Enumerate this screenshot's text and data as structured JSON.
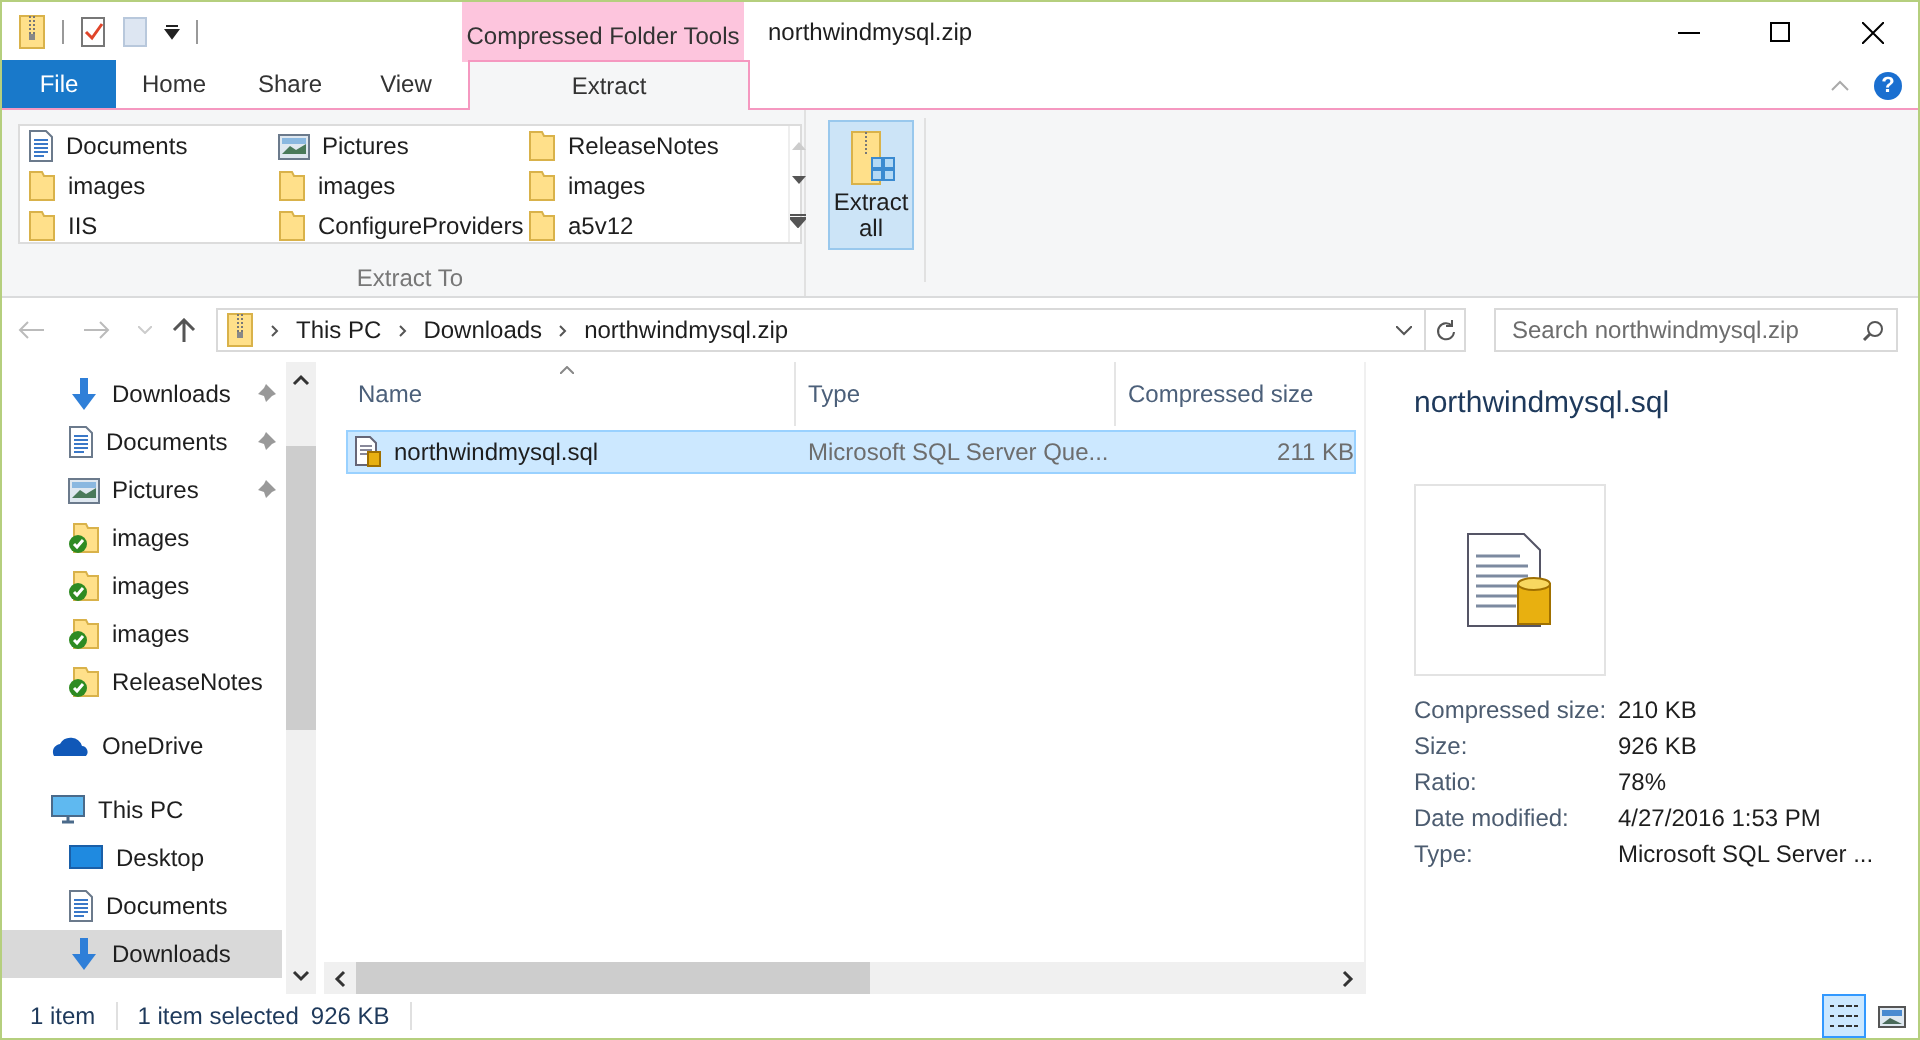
{
  "window": {
    "title": "northwindmysql.zip",
    "context_tab_group": "Compressed Folder Tools"
  },
  "ribbon_tabs": [
    {
      "label": "File",
      "kind": "file",
      "selected": false
    },
    {
      "label": "Home",
      "kind": "tab",
      "selected": false
    },
    {
      "label": "Share",
      "kind": "tab",
      "selected": false
    },
    {
      "label": "View",
      "kind": "tab",
      "selected": false
    },
    {
      "label": "Extract",
      "kind": "context",
      "selected": true
    }
  ],
  "extract_to": {
    "group_label": "Extract To",
    "items": [
      {
        "label": "Documents",
        "kind": "document"
      },
      {
        "label": "Pictures",
        "kind": "picture"
      },
      {
        "label": "ReleaseNotes",
        "kind": "folder"
      },
      {
        "label": "images",
        "kind": "folder"
      },
      {
        "label": "images",
        "kind": "folder"
      },
      {
        "label": "images",
        "kind": "folder"
      },
      {
        "label": "IIS",
        "kind": "folder"
      },
      {
        "label": "ConfigureProviders",
        "kind": "folder"
      },
      {
        "label": "a5v12",
        "kind": "folder"
      }
    ]
  },
  "extract_all_button": {
    "label": "Extract all",
    "selected": true
  },
  "breadcrumb": [
    "This PC",
    "Downloads",
    "northwindmysql.zip"
  ],
  "search": {
    "placeholder": "Search northwindmysql.zip"
  },
  "help_button": {
    "label": "?"
  },
  "sidebar": {
    "quick_access": [
      {
        "label": "Downloads",
        "kind": "download",
        "pinned": true,
        "selected": false
      },
      {
        "label": "Documents",
        "kind": "document",
        "pinned": true,
        "selected": false
      },
      {
        "label": "Pictures",
        "kind": "picture",
        "pinned": true,
        "selected": false
      },
      {
        "label": "images",
        "kind": "synced",
        "pinned": false,
        "selected": false
      },
      {
        "label": "images",
        "kind": "synced",
        "pinned": false,
        "selected": false
      },
      {
        "label": "images",
        "kind": "synced",
        "pinned": false,
        "selected": false
      },
      {
        "label": "ReleaseNotes",
        "kind": "synced",
        "pinned": false,
        "selected": false
      }
    ],
    "locations": [
      {
        "label": "OneDrive",
        "kind": "cloud",
        "selected": false
      },
      {
        "label": "This PC",
        "kind": "pc",
        "selected": false,
        "children": [
          {
            "label": "Desktop",
            "kind": "desktop",
            "selected": false
          },
          {
            "label": "Documents",
            "kind": "document",
            "selected": false
          },
          {
            "label": "Downloads",
            "kind": "download",
            "selected": true
          }
        ]
      }
    ]
  },
  "table": {
    "columns": [
      "Name",
      "Type",
      "Compressed size"
    ],
    "rows": [
      {
        "name": "northwindmysql.sql",
        "type": "Microsoft SQL Server Que...",
        "compressed_size": "211 KB",
        "selected": true
      }
    ]
  },
  "details": {
    "title": "northwindmysql.sql",
    "properties": [
      {
        "label": "Compressed size:",
        "value": "210 KB"
      },
      {
        "label": "Size:",
        "value": "926 KB"
      },
      {
        "label": "Ratio:",
        "value": "78%"
      },
      {
        "label": "Date modified:",
        "value": "4/27/2016 1:53 PM"
      },
      {
        "label": "Type:",
        "value": "Microsoft SQL Server ..."
      }
    ]
  },
  "status_bar": {
    "item_count": "1 item",
    "selection": "1 item selected",
    "selection_size": "926 KB"
  },
  "view_buttons": [
    {
      "kind": "details",
      "selected": true
    },
    {
      "kind": "large-icons",
      "selected": false
    }
  ]
}
